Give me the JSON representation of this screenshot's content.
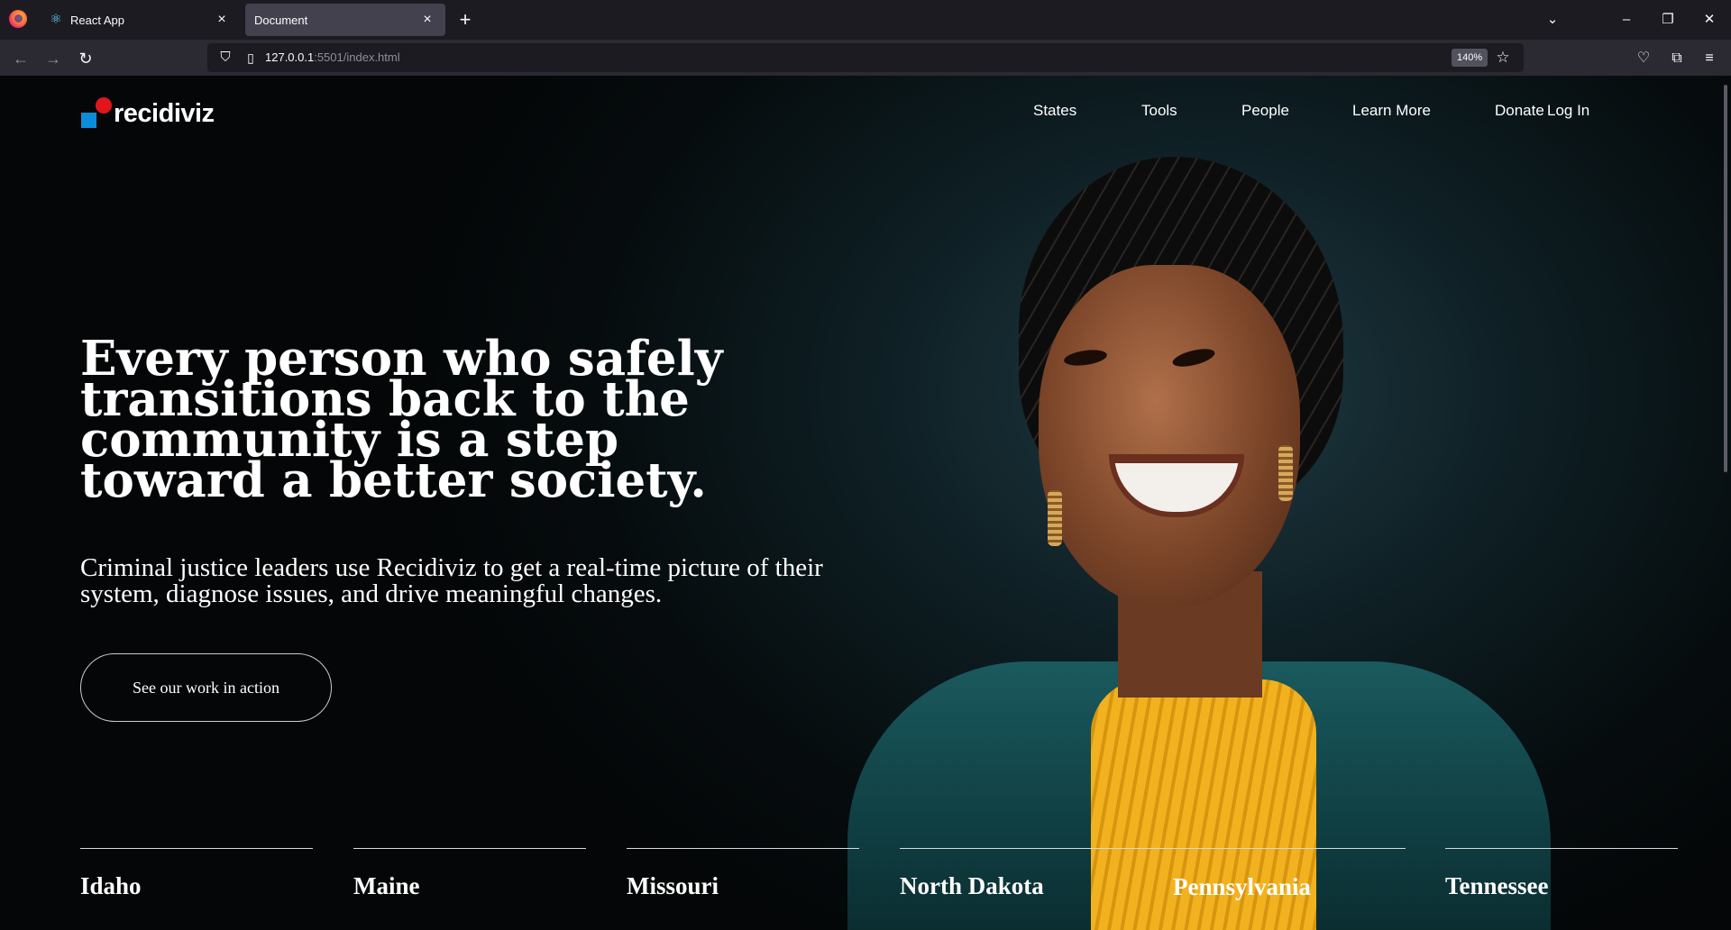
{
  "browser": {
    "tabs": [
      {
        "title": "React App",
        "icon": "react-icon",
        "active": false
      },
      {
        "title": "Document",
        "icon": "",
        "active": true
      }
    ],
    "url_host": "127.0.0.1",
    "url_rest": ":5501/index.html",
    "zoom": "140%"
  },
  "site": {
    "logo_text": "recidiviz",
    "nav": [
      {
        "label": "States"
      },
      {
        "label": "Tools"
      },
      {
        "label": "People"
      },
      {
        "label": "Learn More"
      },
      {
        "label": "Donate"
      },
      {
        "label": "Log In"
      }
    ],
    "hero": {
      "headline": "Every person who safely transitions back to the community is a step toward a better society.",
      "subhead": "Criminal justice leaders use Recidiviz to get a real-time picture of their system, diagnose issues, and drive meaningful changes.",
      "cta_label": "See our work in action"
    },
    "states": [
      {
        "label": "Idaho"
      },
      {
        "label": "Maine"
      },
      {
        "label": "Missouri"
      },
      {
        "label": "North Dakota"
      },
      {
        "label": "Pennsylvania"
      },
      {
        "label": "Tennessee"
      }
    ]
  },
  "colors": {
    "logo_blue": "#0a8ed9",
    "logo_red": "#e1161a",
    "page_bg": "#060c0e"
  }
}
